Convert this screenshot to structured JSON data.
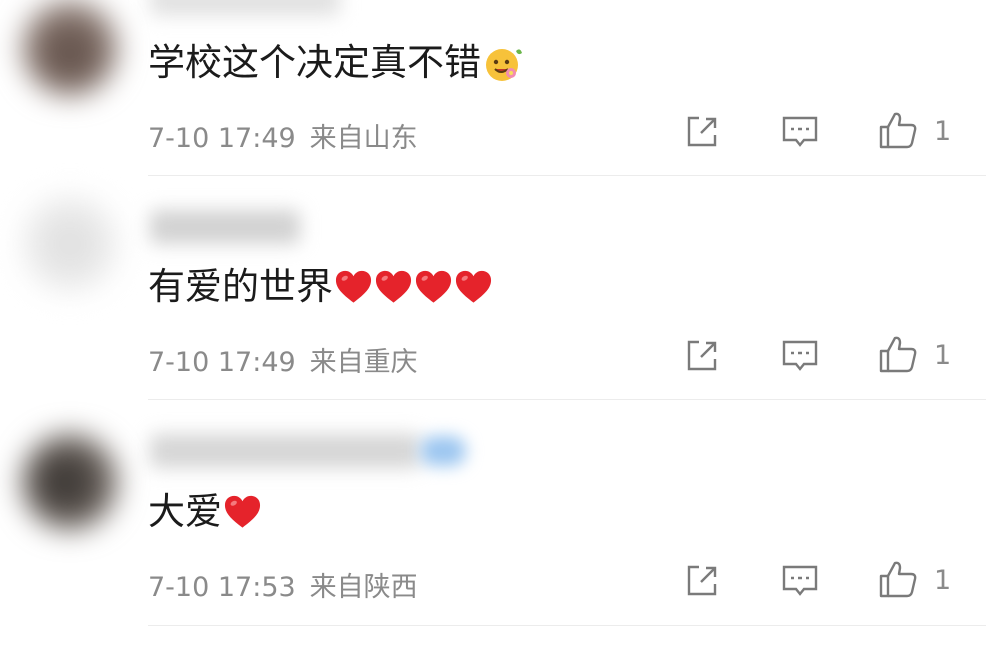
{
  "comments": [
    {
      "text": "学校这个决定真不错",
      "emoji": "smiling-face-with-flower-emoji",
      "hearts": 0,
      "time": "7-10 17:49",
      "location": "来自山东",
      "likes": "1"
    },
    {
      "text": "有爱的世界",
      "emoji": "",
      "hearts": 4,
      "time": "7-10 17:49",
      "location": "来自重庆",
      "likes": "1"
    },
    {
      "text": "大爱",
      "emoji": "",
      "hearts": 1,
      "time": "7-10 17:53",
      "location": "来自陕西",
      "likes": "1"
    }
  ],
  "colors": {
    "heart": "#e5232b",
    "meta_text": "#8a8a8a",
    "icon": "#7a7a7a",
    "divider": "#ececec"
  },
  "icons": [
    "share-icon",
    "reply-icon",
    "thumbs-up-icon"
  ]
}
